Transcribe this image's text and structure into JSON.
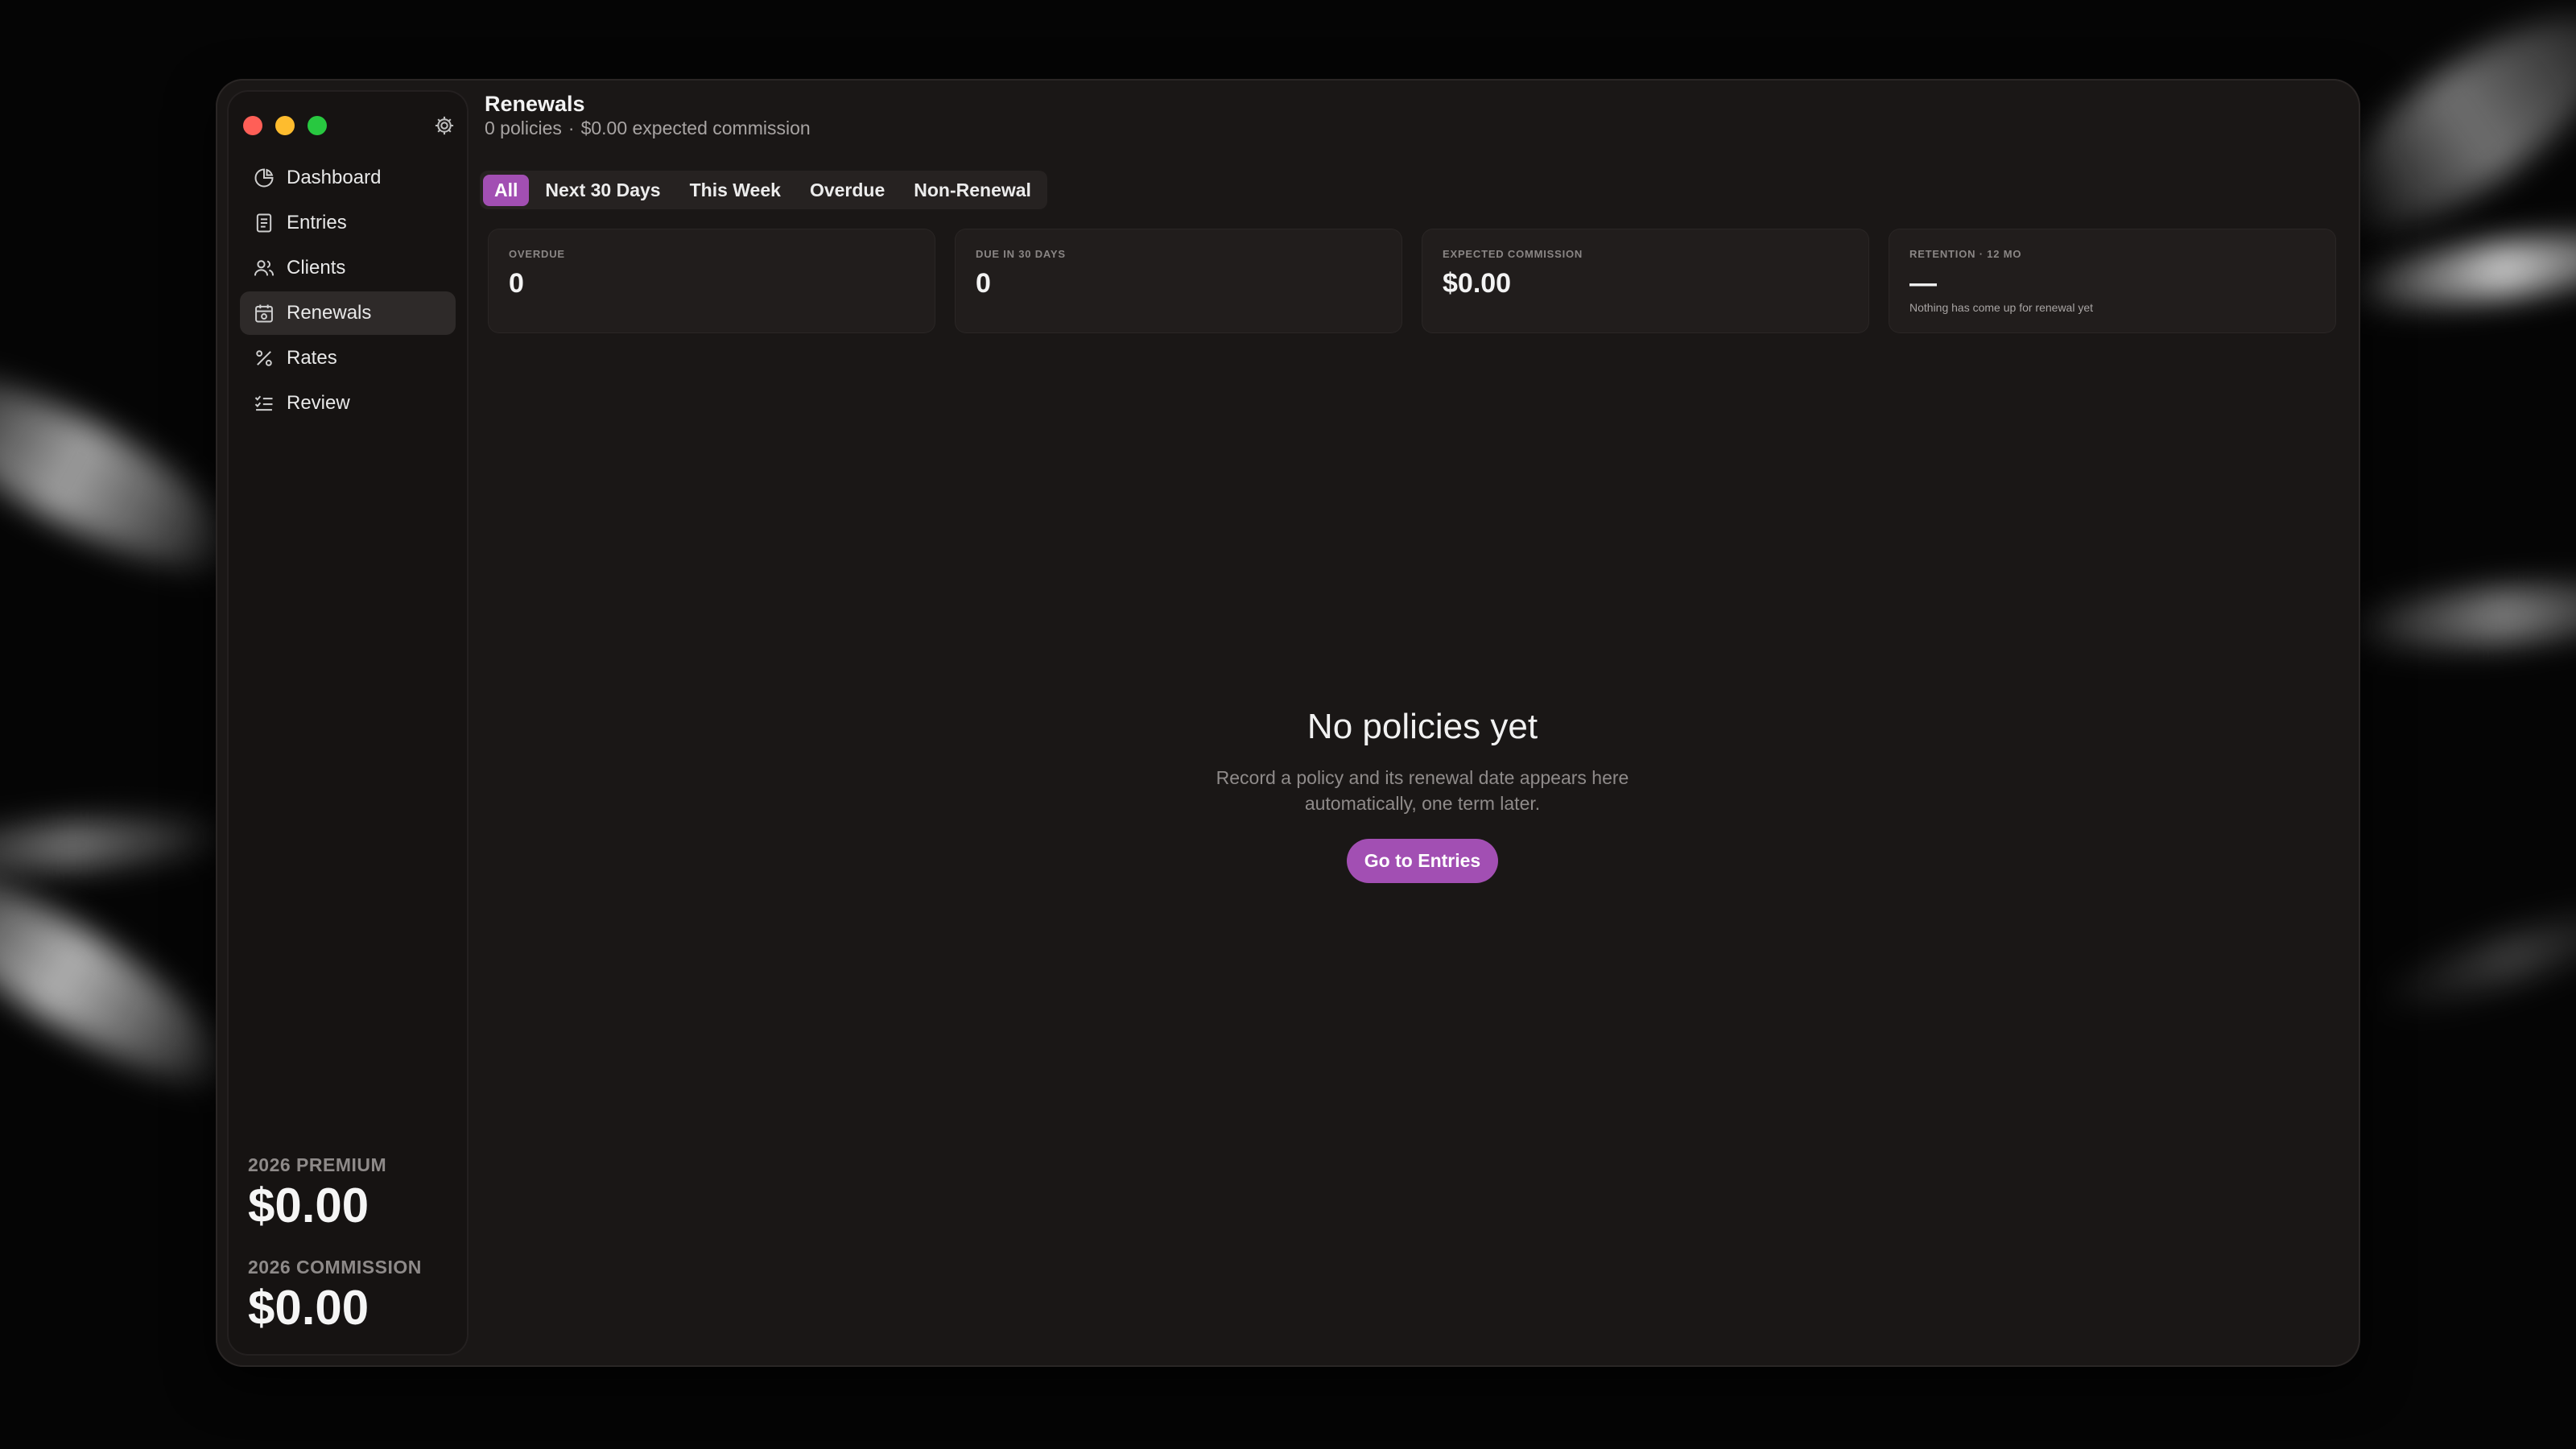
{
  "sidebar": {
    "items": [
      {
        "label": "Dashboard",
        "icon": "pie-chart-icon"
      },
      {
        "label": "Entries",
        "icon": "document-icon"
      },
      {
        "label": "Clients",
        "icon": "users-icon"
      },
      {
        "label": "Renewals",
        "icon": "calendar-icon",
        "active": true
      },
      {
        "label": "Rates",
        "icon": "percent-icon"
      },
      {
        "label": "Review",
        "icon": "checklist-icon"
      }
    ],
    "premium_label": "2026 PREMIUM",
    "premium_value": "$0.00",
    "commission_label": "2026 COMMISSION",
    "commission_value": "$0.00"
  },
  "header": {
    "title": "Renewals",
    "policies": "0 policies",
    "separator": "·",
    "commission": "$0.00 expected commission"
  },
  "tabs": [
    "All",
    "Next 30 Days",
    "This Week",
    "Overdue",
    "Non-Renewal"
  ],
  "active_tab": "All",
  "cards": [
    {
      "label": "OVERDUE",
      "value": "0",
      "note": ""
    },
    {
      "label": "DUE IN 30 DAYS",
      "value": "0",
      "note": ""
    },
    {
      "label": "EXPECTED COMMISSION",
      "value": "$0.00",
      "note": ""
    },
    {
      "label": "RETENTION · 12 MO",
      "value": "—",
      "note": "Nothing has come up for renewal yet"
    }
  ],
  "empty_state": {
    "title": "No policies yet",
    "text": "Record a policy and its renewal date appears here automatically, one term later.",
    "button": "Go to Entries"
  },
  "colors": {
    "accent": "#a24fb3",
    "window_bg": "#1a1716",
    "sidebar_bg": "#161312",
    "close": "#ff5f57",
    "minimize": "#febc2e",
    "zoom": "#28c840"
  }
}
